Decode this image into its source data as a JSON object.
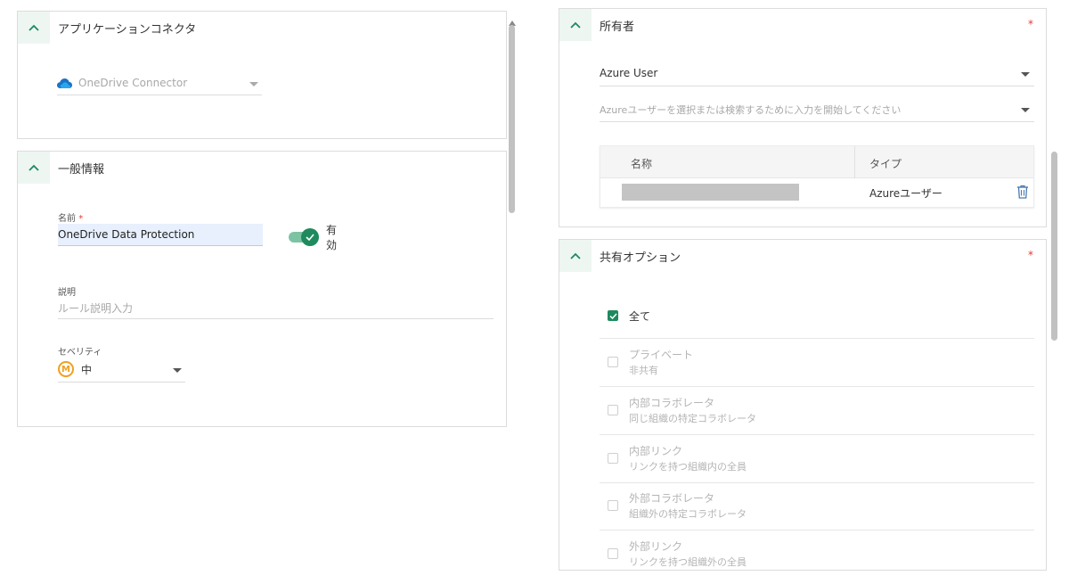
{
  "connector_section": {
    "title": "アプリケーションコネクタ",
    "connector_value": "OneDrive Connector"
  },
  "general_section": {
    "title": "一般情報",
    "name_label": "名前",
    "name_value": "OneDrive Data Protection",
    "toggle_label_1": "有",
    "toggle_label_2": "効",
    "toggle_on": true,
    "description_label": "説明",
    "description_placeholder": "ルール説明入力",
    "severity_label": "セベリティ",
    "severity_badge": "M",
    "severity_value": "中"
  },
  "owner_section": {
    "title": "所有者",
    "required_mark": "*",
    "user_type_value": "Azure User",
    "search_placeholder": "Azureユーザーを選択または検索するために入力を開始してください",
    "table": {
      "headers": [
        "名称",
        "タイプ"
      ],
      "rows": [
        {
          "name": "",
          "type": "Azureユーザー"
        }
      ]
    }
  },
  "sharing_section": {
    "title": "共有オプション",
    "required_mark": "*",
    "options": [
      {
        "title": "全て",
        "subtitle": "",
        "checked": true
      },
      {
        "title": "プライベート",
        "subtitle": "非共有",
        "checked": false
      },
      {
        "title": "内部コラボレータ",
        "subtitle": "同じ組織の特定コラボレータ",
        "checked": false
      },
      {
        "title": "内部リンク",
        "subtitle": "リンクを持つ組織内の全員",
        "checked": false
      },
      {
        "title": "外部コラボレータ",
        "subtitle": "組織外の特定コラボレータ",
        "checked": false
      },
      {
        "title": "外部リンク",
        "subtitle": "リンクを持つ組織外の全員",
        "checked": false
      }
    ]
  },
  "colors": {
    "accent": "#1e8a5e",
    "required": "#e53935",
    "severity": "#f0a020",
    "onedrive": "#1a73c9"
  }
}
